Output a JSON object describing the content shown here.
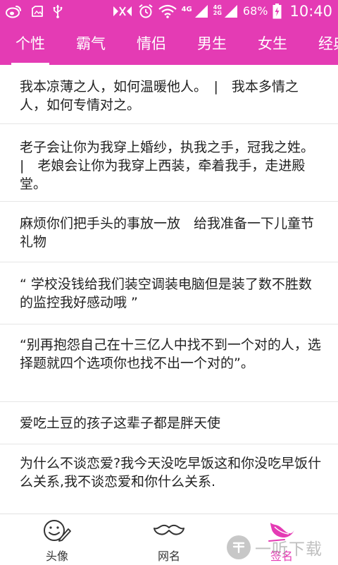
{
  "status_bar": {
    "icons": [
      "weibo-icon",
      "image-icon",
      "usb-icon",
      "mute-icon",
      "alarm-icon",
      "wifi-icon",
      "signal-icon",
      "signal-icon",
      "battery-charging-icon"
    ],
    "network_primary": "4G",
    "network_secondary_top": "4G",
    "network_secondary_bottom": "2G",
    "battery": "68%",
    "time": "10:40"
  },
  "tabs": [
    {
      "label": "个性",
      "active": true
    },
    {
      "label": "霸气",
      "active": false
    },
    {
      "label": "情侣",
      "active": false
    },
    {
      "label": "男生",
      "active": false
    },
    {
      "label": "女生",
      "active": false
    },
    {
      "label": "经典",
      "active": false
    }
  ],
  "signatures": [
    "我本凉薄之人，如何温暖他人。　|　我本多情之人，如何专情对之。",
    "老子会让你为我穿上婚纱，执我之手，冠我之姓。　|　老娘会让你为我穿上西装，牵着我手，走进殿堂。",
    "麻烦你们把手头的事放一放　给我准备一下儿童节礼物",
    "“ 学校没钱给我们装空调装电脑但是装了数不胜数的监控我好感动哦 ”",
    "“别再抱怨自己在十三亿人中找不到一个对的人，选择题就四个选项你也找不出一个对的”。",
    "爱吃土豆的孩子这辈子都是胖天使",
    "为什么不谈恋爱?我今天没吃早饭这和你没吃早饭什么关系,我不谈恋爱和你什么关系."
  ],
  "bottom_nav": [
    {
      "label": "头像",
      "icon": "smiley-pencil-icon",
      "active": false
    },
    {
      "label": "网名",
      "icon": "mustache-icon",
      "active": false
    },
    {
      "label": "签名",
      "icon": "feather-pen-icon",
      "active": true
    }
  ],
  "watermark": {
    "text": "一听下载"
  },
  "colors": {
    "accent": "#e43bb4",
    "text": "#222222",
    "divider": "#e6e6e6"
  }
}
